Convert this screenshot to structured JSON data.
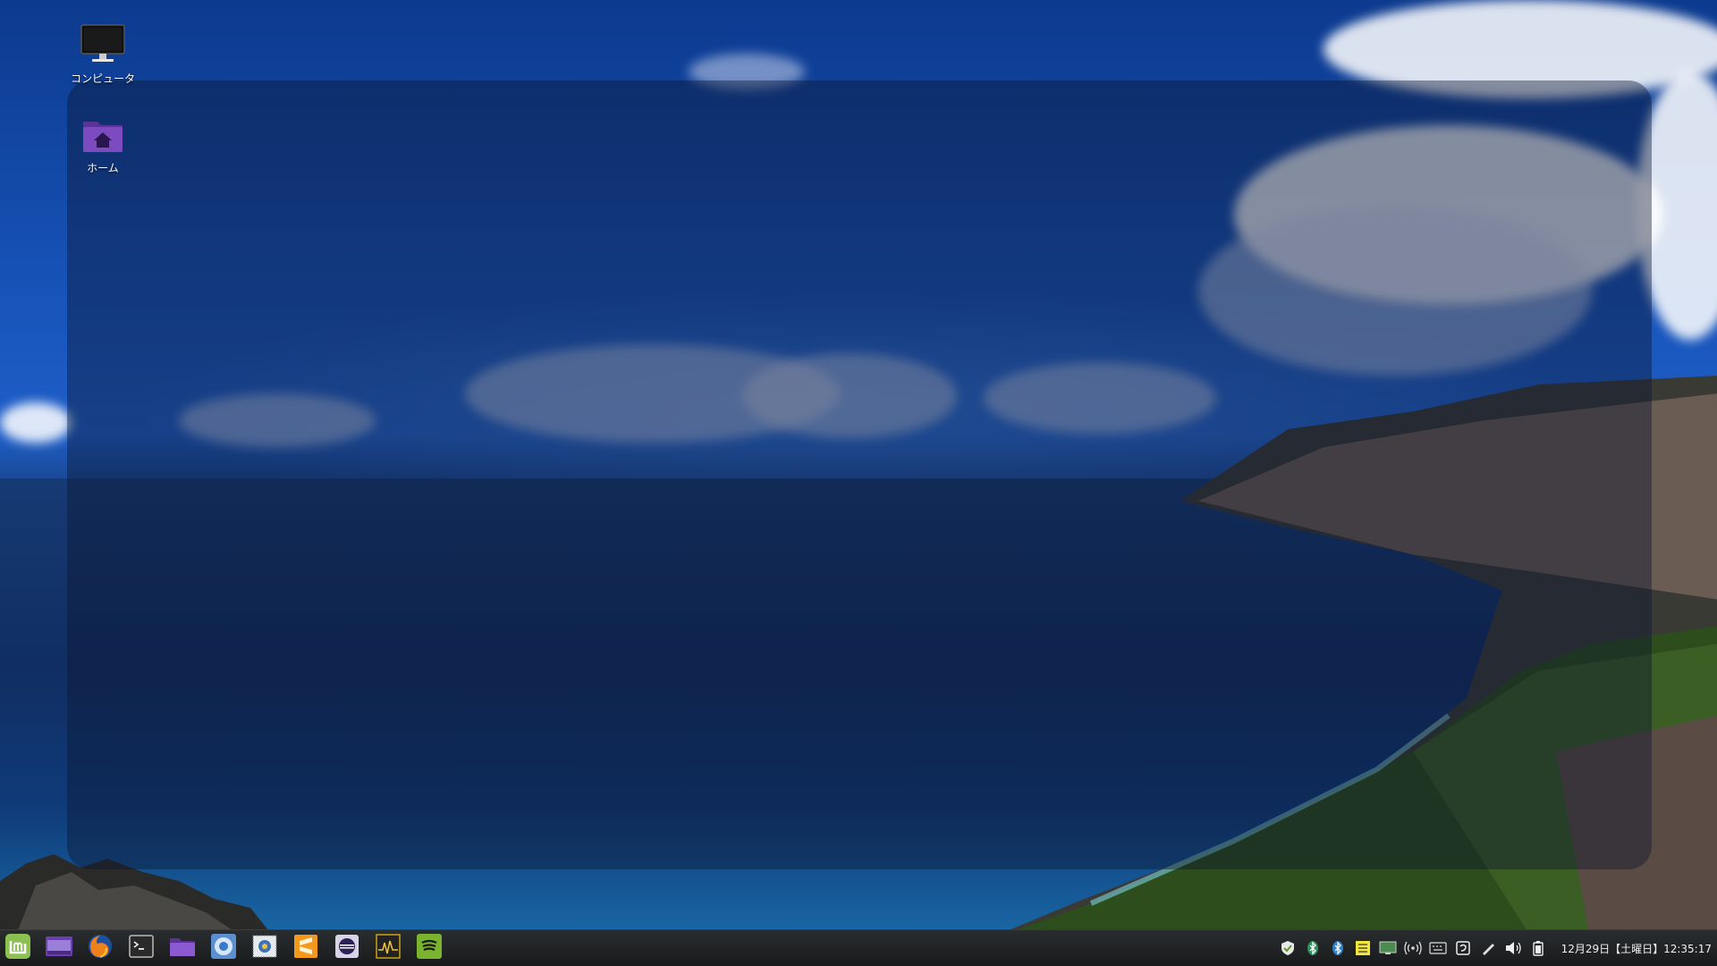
{
  "desktop": {
    "icons": [
      {
        "label": "コンピュータ",
        "icon": "monitor-icon"
      },
      {
        "label": "ホーム",
        "icon": "home-folder-icon"
      }
    ]
  },
  "taskbar": {
    "launchers": [
      {
        "name": "menu-button",
        "icon": "linux-mint-logo-icon"
      },
      {
        "name": "show-desktop-button",
        "icon": "show-desktop-icon"
      },
      {
        "name": "firefox-launcher",
        "icon": "firefox-icon"
      },
      {
        "name": "terminal-launcher",
        "icon": "terminal-icon"
      },
      {
        "name": "files-launcher",
        "icon": "folder-icon"
      },
      {
        "name": "chromium-launcher",
        "icon": "chromium-icon"
      },
      {
        "name": "mail-launcher",
        "icon": "mail-icon"
      },
      {
        "name": "sublime-launcher",
        "icon": "sublime-text-icon"
      },
      {
        "name": "eclipse-launcher",
        "icon": "eclipse-icon"
      },
      {
        "name": "system-monitor-launcher",
        "icon": "system-monitor-icon"
      },
      {
        "name": "spotify-launcher",
        "icon": "spotify-icon"
      }
    ],
    "tray": [
      {
        "name": "shield-icon"
      },
      {
        "name": "bluetooth-icon-1"
      },
      {
        "name": "bluetooth-icon-2"
      },
      {
        "name": "notes-icon"
      },
      {
        "name": "display-icon"
      },
      {
        "name": "network-wireless-icon"
      },
      {
        "name": "keyboard-icon"
      },
      {
        "name": "input-method-icon"
      },
      {
        "name": "pen-icon"
      },
      {
        "name": "volume-icon"
      },
      {
        "name": "battery-icon"
      }
    ],
    "clock": "12月29日【土曜日】12:35:17"
  },
  "colors": {
    "accent_green": "#8cc152",
    "folder_purple": "#7b4bbf",
    "taskbar_bg": "#1c1e1f"
  }
}
